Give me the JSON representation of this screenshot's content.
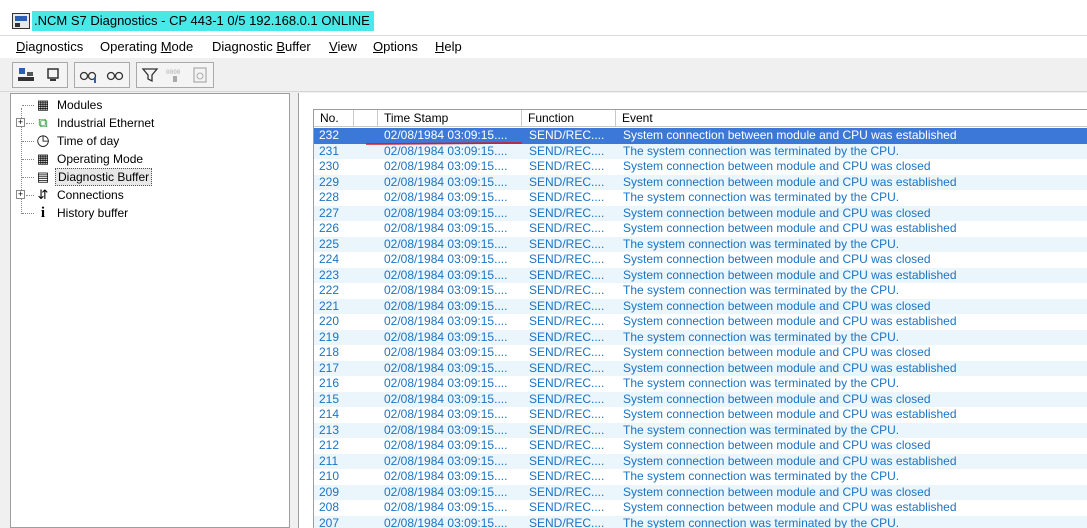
{
  "window": {
    "title": ".NCM S7 Diagnostics - CP 443-1 0/5 192.168.0.1  ONLINE"
  },
  "menu": [
    {
      "pre": "D",
      "rest": "iagnostics"
    },
    {
      "pre": "Operating ",
      "u": "M",
      "rest": "ode"
    },
    {
      "pre": "Diagnostic ",
      "u": "B",
      "rest": "uffer"
    },
    {
      "u": "V",
      "rest": "iew"
    },
    {
      "u": "O",
      "rest": "ptions"
    },
    {
      "u": "H",
      "rest": "elp"
    }
  ],
  "tree": {
    "items": [
      {
        "label": "Modules",
        "icon": "modules-icon",
        "glyph": "▦"
      },
      {
        "label": "Industrial Ethernet",
        "icon": "network-icon",
        "glyph": "⧉",
        "expand": "+"
      },
      {
        "label": "Time of day",
        "icon": "clock-icon",
        "glyph": "◷"
      },
      {
        "label": "Operating Mode",
        "icon": "operating-mode-icon",
        "glyph": "▦"
      },
      {
        "label": "Diagnostic Buffer",
        "icon": "buffer-icon",
        "glyph": "▤",
        "selected": true
      },
      {
        "label": "Connections",
        "icon": "connections-icon",
        "glyph": "⇵",
        "expand": "+"
      },
      {
        "label": "History buffer",
        "icon": "info-icon",
        "glyph": "i"
      }
    ]
  },
  "table": {
    "headers": [
      "No.",
      "Time Stamp",
      "Function",
      "Event"
    ],
    "rows": [
      [
        "232",
        "02/08/1984 03:09:15....",
        "SEND/REC....",
        "System connection between module and CPU was established"
      ],
      [
        "231",
        "02/08/1984 03:09:15....",
        "SEND/REC....",
        "The system connection was terminated by the CPU."
      ],
      [
        "230",
        "02/08/1984 03:09:15....",
        "SEND/REC....",
        "System connection between module and CPU was closed"
      ],
      [
        "229",
        "02/08/1984 03:09:15....",
        "SEND/REC....",
        "System connection between module and CPU was established"
      ],
      [
        "228",
        "02/08/1984 03:09:15....",
        "SEND/REC....",
        "The system connection was terminated by the CPU."
      ],
      [
        "227",
        "02/08/1984 03:09:15....",
        "SEND/REC....",
        "System connection between module and CPU was closed"
      ],
      [
        "226",
        "02/08/1984 03:09:15....",
        "SEND/REC....",
        "System connection between module and CPU was established"
      ],
      [
        "225",
        "02/08/1984 03:09:15....",
        "SEND/REC....",
        "The system connection was terminated by the CPU."
      ],
      [
        "224",
        "02/08/1984 03:09:15....",
        "SEND/REC....",
        "System connection between module and CPU was closed"
      ],
      [
        "223",
        "02/08/1984 03:09:15....",
        "SEND/REC....",
        "System connection between module and CPU was established"
      ],
      [
        "222",
        "02/08/1984 03:09:15....",
        "SEND/REC....",
        "The system connection was terminated by the CPU."
      ],
      [
        "221",
        "02/08/1984 03:09:15....",
        "SEND/REC....",
        "System connection between module and CPU was closed"
      ],
      [
        "220",
        "02/08/1984 03:09:15....",
        "SEND/REC....",
        "System connection between module and CPU was established"
      ],
      [
        "219",
        "02/08/1984 03:09:15....",
        "SEND/REC....",
        "The system connection was terminated by the CPU."
      ],
      [
        "218",
        "02/08/1984 03:09:15....",
        "SEND/REC....",
        "System connection between module and CPU was closed"
      ],
      [
        "217",
        "02/08/1984 03:09:15....",
        "SEND/REC....",
        "System connection between module and CPU was established"
      ],
      [
        "216",
        "02/08/1984 03:09:15....",
        "SEND/REC....",
        "The system connection was terminated by the CPU."
      ],
      [
        "215",
        "02/08/1984 03:09:15....",
        "SEND/REC....",
        "System connection between module and CPU was closed"
      ],
      [
        "214",
        "02/08/1984 03:09:15....",
        "SEND/REC....",
        "System connection between module and CPU was established"
      ],
      [
        "213",
        "02/08/1984 03:09:15....",
        "SEND/REC....",
        "The system connection was terminated by the CPU."
      ],
      [
        "212",
        "02/08/1984 03:09:15....",
        "SEND/REC....",
        "System connection between module and CPU was closed"
      ],
      [
        "211",
        "02/08/1984 03:09:15....",
        "SEND/REC....",
        "System connection between module and CPU was established"
      ],
      [
        "210",
        "02/08/1984 03:09:15....",
        "SEND/REC....",
        "The system connection was terminated by the CPU."
      ],
      [
        "209",
        "02/08/1984 03:09:15....",
        "SEND/REC....",
        "System connection between module and CPU was closed"
      ],
      [
        "208",
        "02/08/1984 03:09:15....",
        "SEND/REC....",
        "System connection between module and CPU was established"
      ],
      [
        "207",
        "02/08/1984 03:09:15....",
        "SEND/REC....",
        "The system connection was terminated by the CPU."
      ]
    ],
    "selected_row": 0
  },
  "colors": {
    "title_highlight": "#49e9ea",
    "selection": "#3c78d8",
    "row_text": "#1c73c4",
    "row_stripe": "#eaf6fb",
    "annotation": "#d9191c"
  }
}
